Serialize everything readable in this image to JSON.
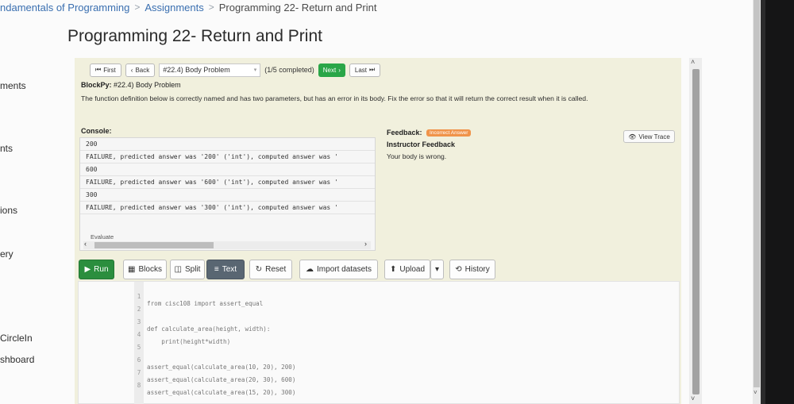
{
  "breadcrumb": {
    "items": [
      "ndamentals of Programming",
      "Assignments",
      "Programming 22- Return and Print"
    ],
    "separator": ">"
  },
  "sidebar": {
    "items": [
      "ments",
      "nts",
      "ions",
      "ery",
      "CircleIn",
      "shboard"
    ]
  },
  "page": {
    "title": "Programming 22- Return and Print"
  },
  "nav": {
    "first_label": "First",
    "back_label": "Back",
    "problem_select": "#22.4) Body Problem",
    "progress": "(1/5 completed)",
    "next_label": "Next",
    "last_label": "Last"
  },
  "problem": {
    "prefix": "BlockPy:",
    "title": "#22.4) Body Problem",
    "description": "The function definition below is correctly named and has two parameters, but has an error in its body. Fix the error so that it will return the correct result when it is called."
  },
  "console": {
    "label": "Console:",
    "lines": [
      "200",
      "FAILURE, predicted answer was '200' ('int'), computed answer was '",
      "600",
      "FAILURE, predicted answer was '600' ('int'), computed answer was '",
      "300",
      "FAILURE, predicted answer was '300' ('int'), computed answer was '"
    ],
    "evaluate_label": "Evaluate"
  },
  "feedback": {
    "label": "Feedback:",
    "badge": "Incorrect Answer",
    "badge_color": "#f0934a",
    "instructor_label": "Instructor Feedback",
    "text": "Your body is wrong.",
    "view_trace_label": "View Trace"
  },
  "toolbar": {
    "run": "Run",
    "blocks": "Blocks",
    "split": "Split",
    "text": "Text",
    "reset": "Reset",
    "import": "Import datasets",
    "upload": "Upload",
    "history": "History",
    "active_mode": "Text",
    "run_color": "#2b8e3e"
  },
  "code": {
    "lines": [
      {
        "num": "1",
        "text": "from cisc108 import assert_equal"
      },
      {
        "num": "2",
        "text": ""
      },
      {
        "num": "3",
        "text": "def calculate_area(height, width):"
      },
      {
        "num": "4",
        "text": "    print(height*width)"
      },
      {
        "num": "5",
        "text": ""
      },
      {
        "num": "6",
        "text": "assert_equal(calculate_area(10, 20), 200)"
      },
      {
        "num": "7",
        "text": "assert_equal(calculate_area(20, 30), 600)"
      },
      {
        "num": "8",
        "text": "assert_equal(calculate_area(15, 20), 300)"
      }
    ]
  }
}
